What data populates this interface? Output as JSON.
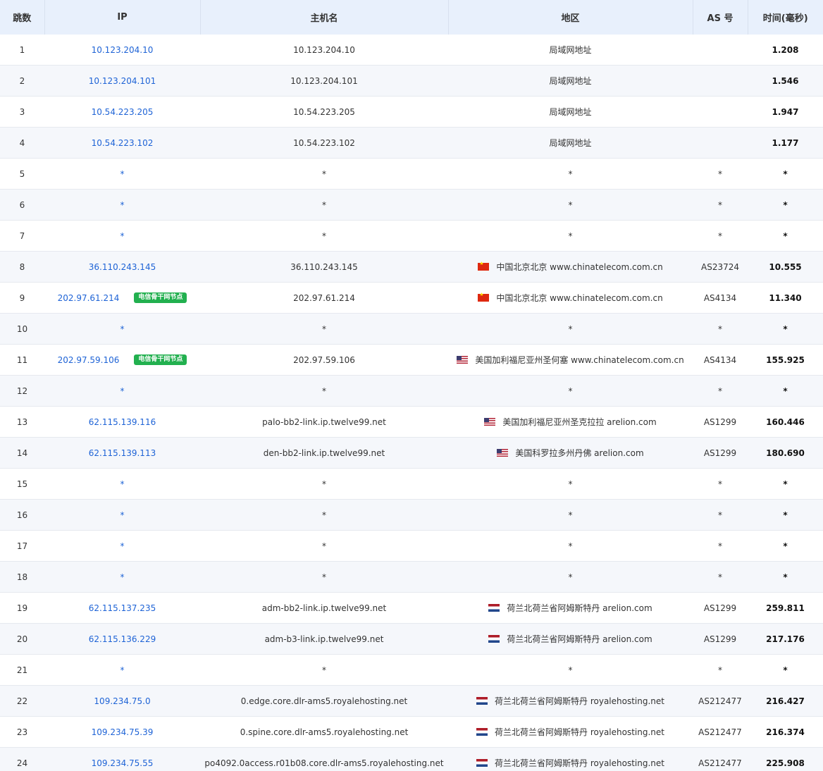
{
  "columns": [
    "跳数",
    "IP",
    "主机名",
    "地区",
    "AS 号",
    "时间(毫秒)"
  ],
  "rows": [
    {
      "hop": "1",
      "ip": "10.123.204.10",
      "badge": "",
      "host": "10.123.204.10",
      "flag": "",
      "region": "局域网地址",
      "as": "",
      "time": "1.208"
    },
    {
      "hop": "2",
      "ip": "10.123.204.101",
      "badge": "",
      "host": "10.123.204.101",
      "flag": "",
      "region": "局域网地址",
      "as": "",
      "time": "1.546"
    },
    {
      "hop": "3",
      "ip": "10.54.223.205",
      "badge": "",
      "host": "10.54.223.205",
      "flag": "",
      "region": "局域网地址",
      "as": "",
      "time": "1.947"
    },
    {
      "hop": "4",
      "ip": "10.54.223.102",
      "badge": "",
      "host": "10.54.223.102",
      "flag": "",
      "region": "局域网地址",
      "as": "",
      "time": "1.177"
    },
    {
      "hop": "5",
      "ip": "*",
      "badge": "",
      "host": "*",
      "flag": "",
      "region": "*",
      "as": "*",
      "time": "*"
    },
    {
      "hop": "6",
      "ip": "*",
      "badge": "",
      "host": "*",
      "flag": "",
      "region": "*",
      "as": "*",
      "time": "*"
    },
    {
      "hop": "7",
      "ip": "*",
      "badge": "",
      "host": "*",
      "flag": "",
      "region": "*",
      "as": "*",
      "time": "*"
    },
    {
      "hop": "8",
      "ip": "36.110.243.145",
      "badge": "",
      "host": "36.110.243.145",
      "flag": "cn",
      "region": "中国北京北京 www.chinatelecom.com.cn",
      "as": "AS23724",
      "time": "10.555"
    },
    {
      "hop": "9",
      "ip": "202.97.61.214",
      "badge": "电信骨干网节点",
      "host": "202.97.61.214",
      "flag": "cn",
      "region": "中国北京北京 www.chinatelecom.com.cn",
      "as": "AS4134",
      "time": "11.340"
    },
    {
      "hop": "10",
      "ip": "*",
      "badge": "",
      "host": "*",
      "flag": "",
      "region": "*",
      "as": "*",
      "time": "*"
    },
    {
      "hop": "11",
      "ip": "202.97.59.106",
      "badge": "电信骨干网节点",
      "host": "202.97.59.106",
      "flag": "us",
      "region": "美国加利福尼亚州圣何塞 www.chinatelecom.com.cn",
      "as": "AS4134",
      "time": "155.925"
    },
    {
      "hop": "12",
      "ip": "*",
      "badge": "",
      "host": "*",
      "flag": "",
      "region": "*",
      "as": "*",
      "time": "*"
    },
    {
      "hop": "13",
      "ip": "62.115.139.116",
      "badge": "",
      "host": "palo-bb2-link.ip.twelve99.net",
      "flag": "us",
      "region": "美国加利福尼亚州圣克拉拉 arelion.com",
      "as": "AS1299",
      "time": "160.446"
    },
    {
      "hop": "14",
      "ip": "62.115.139.113",
      "badge": "",
      "host": "den-bb2-link.ip.twelve99.net",
      "flag": "us",
      "region": "美国科罗拉多州丹佛 arelion.com",
      "as": "AS1299",
      "time": "180.690"
    },
    {
      "hop": "15",
      "ip": "*",
      "badge": "",
      "host": "*",
      "flag": "",
      "region": "*",
      "as": "*",
      "time": "*"
    },
    {
      "hop": "16",
      "ip": "*",
      "badge": "",
      "host": "*",
      "flag": "",
      "region": "*",
      "as": "*",
      "time": "*"
    },
    {
      "hop": "17",
      "ip": "*",
      "badge": "",
      "host": "*",
      "flag": "",
      "region": "*",
      "as": "*",
      "time": "*"
    },
    {
      "hop": "18",
      "ip": "*",
      "badge": "",
      "host": "*",
      "flag": "",
      "region": "*",
      "as": "*",
      "time": "*"
    },
    {
      "hop": "19",
      "ip": "62.115.137.235",
      "badge": "",
      "host": "adm-bb2-link.ip.twelve99.net",
      "flag": "nl",
      "region": "荷兰北荷兰省阿姆斯特丹 arelion.com",
      "as": "AS1299",
      "time": "259.811"
    },
    {
      "hop": "20",
      "ip": "62.115.136.229",
      "badge": "",
      "host": "adm-b3-link.ip.twelve99.net",
      "flag": "nl",
      "region": "荷兰北荷兰省阿姆斯特丹 arelion.com",
      "as": "AS1299",
      "time": "217.176"
    },
    {
      "hop": "21",
      "ip": "*",
      "badge": "",
      "host": "*",
      "flag": "",
      "region": "*",
      "as": "*",
      "time": "*"
    },
    {
      "hop": "22",
      "ip": "109.234.75.0",
      "badge": "",
      "host": "0.edge.core.dlr-ams5.royalehosting.net",
      "flag": "nl",
      "region": "荷兰北荷兰省阿姆斯特丹 royalehosting.net",
      "as": "AS212477",
      "time": "216.427"
    },
    {
      "hop": "23",
      "ip": "109.234.75.39",
      "badge": "",
      "host": "0.spine.core.dlr-ams5.royalehosting.net",
      "flag": "nl",
      "region": "荷兰北荷兰省阿姆斯特丹 royalehosting.net",
      "as": "AS212477",
      "time": "216.374"
    },
    {
      "hop": "24",
      "ip": "109.234.75.55",
      "badge": "",
      "host": "po4092.0access.r01b08.core.dlr-ams5.royalehosting.net",
      "flag": "nl",
      "region": "荷兰北荷兰省阿姆斯特丹 royalehosting.net",
      "as": "AS212477",
      "time": "225.908"
    }
  ]
}
